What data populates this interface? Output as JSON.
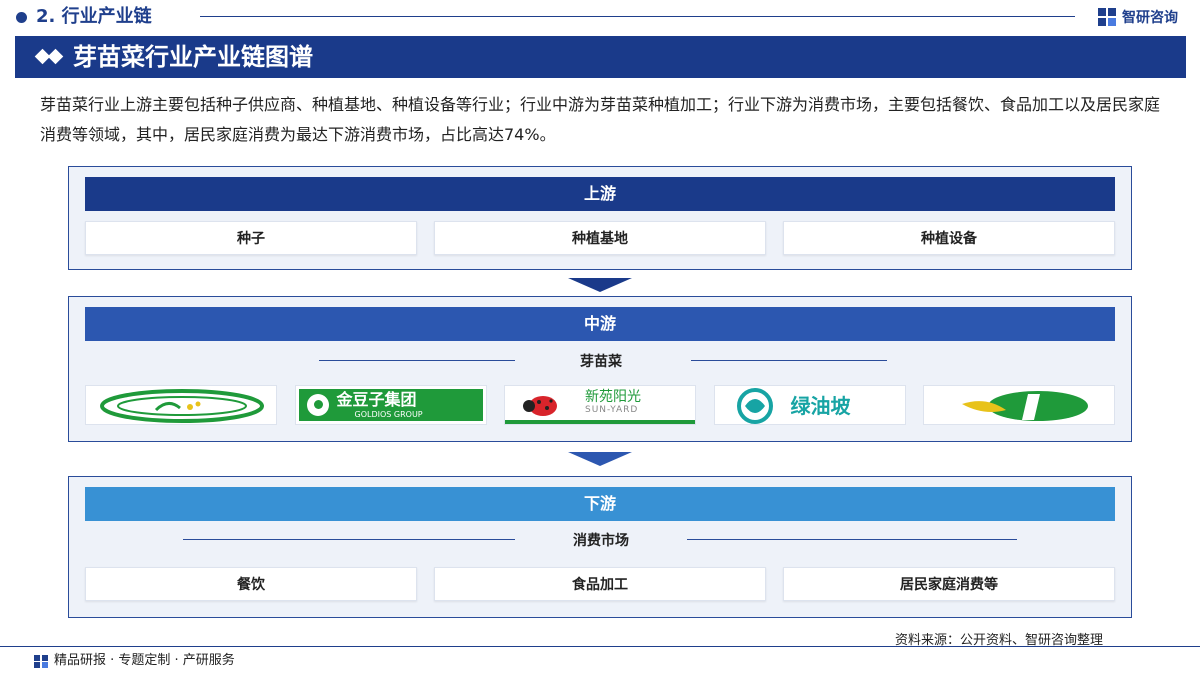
{
  "header": {
    "section_title": "2. 行业产业链",
    "brand": "智研咨询"
  },
  "banner": {
    "title": "芽苗菜行业产业链图谱"
  },
  "description": "芽苗菜行业上游主要包括种子供应商、种植基地、种植设备等行业；行业中游为芽苗菜种植加工；行业下游为消费市场，主要包括餐饮、食品加工以及居民家庭消费等领域，其中，居民家庭消费为最达下游消费市场，占比高达74%。",
  "upstream": {
    "title": "上游",
    "items": [
      "种子",
      "种植基地",
      "种植设备"
    ]
  },
  "midstream": {
    "title": "中游",
    "subtitle": "芽苗菜",
    "logos": [
      {
        "icon": "green-oval-logo",
        "text": ""
      },
      {
        "icon": "goldios-logo",
        "text": "金豆子集团",
        "subtext": "GOLDIOS GROUP"
      },
      {
        "icon": "sun-yard-logo",
        "text": "新苑阳光",
        "subtext": "SUN-YARD"
      },
      {
        "icon": "lvyoupo-logo",
        "text": "绿油坡"
      },
      {
        "icon": "green-leaf-logo",
        "text": ""
      }
    ]
  },
  "downstream": {
    "title": "下游",
    "subtitle": "消费市场",
    "items": [
      "餐饮",
      "食品加工",
      "居民家庭消费等"
    ]
  },
  "footer": {
    "left": "精品研报 · 专题定制 · 产研服务",
    "source": "资料来源：公开资料、智研咨询整理"
  },
  "colors": {
    "navy": "#1a3a8a",
    "mid_blue": "#2c57b0",
    "light_blue": "#3891d4",
    "logo_green": "#1f9a3a"
  }
}
